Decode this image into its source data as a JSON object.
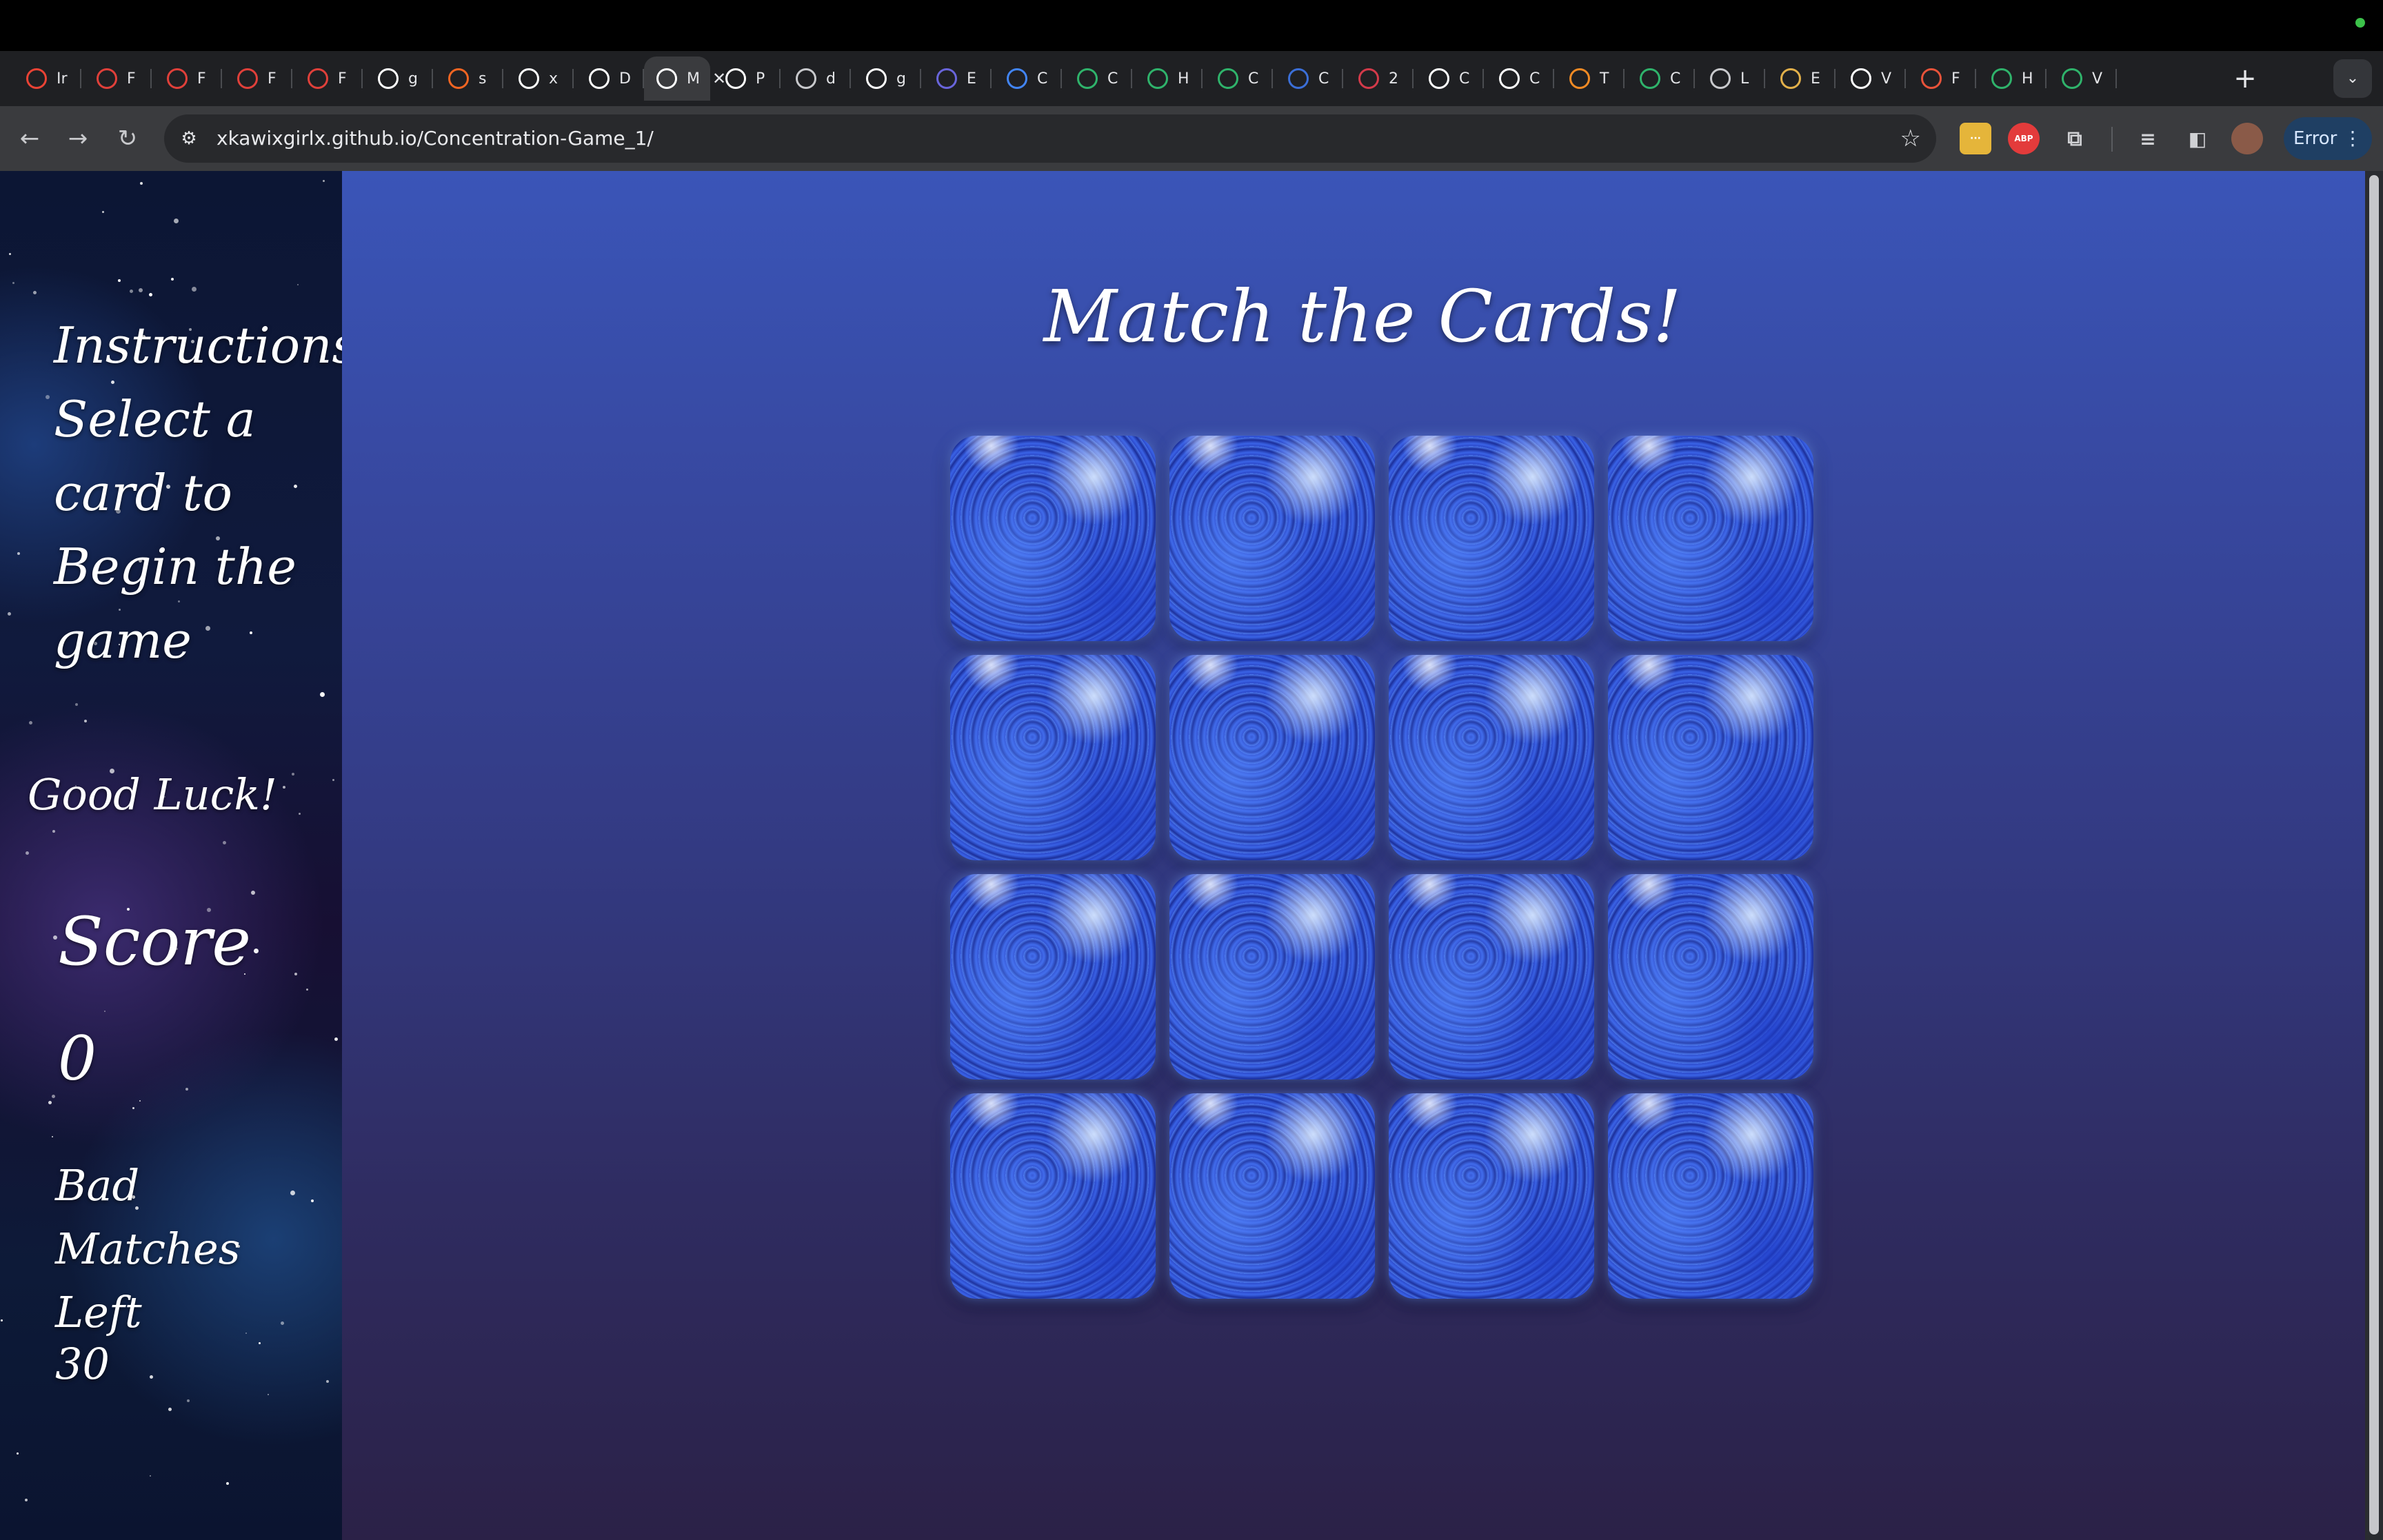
{
  "browser": {
    "tabs": [
      {
        "icon": "gmail-icon",
        "title": "Ir",
        "color": "#ea4335"
      },
      {
        "icon": "ga-icon",
        "title": "F",
        "color": "#e0403a"
      },
      {
        "icon": "ga-icon",
        "title": "F",
        "color": "#e0403a"
      },
      {
        "icon": "ga-icon",
        "title": "F",
        "color": "#e0403a"
      },
      {
        "icon": "ga-icon",
        "title": "F",
        "color": "#e0403a"
      },
      {
        "icon": "github-icon",
        "title": "g",
        "color": "#ffffff"
      },
      {
        "icon": "sourcetree-icon",
        "title": "s",
        "color": "#f26522"
      },
      {
        "icon": "github-icon",
        "title": "x",
        "color": "#ffffff"
      },
      {
        "icon": "github-icon",
        "title": "D",
        "color": "#ffffff"
      },
      {
        "icon": "page-icon",
        "title": "M",
        "color": "#ffffff",
        "active": true
      },
      {
        "icon": "github-icon",
        "title": "P",
        "color": "#ffffff"
      },
      {
        "icon": "globe-icon",
        "title": "d",
        "color": "#c8c9cc"
      },
      {
        "icon": "github-icon",
        "title": "g",
        "color": "#ffffff"
      },
      {
        "icon": "excalidraw-icon",
        "title": "E",
        "color": "#6965db"
      },
      {
        "icon": "google-icon",
        "title": "C",
        "color": "#4285f4"
      },
      {
        "icon": "wix-icon",
        "title": "C",
        "color": "#2fb36b"
      },
      {
        "icon": "wix-icon",
        "title": "H",
        "color": "#2fb36b"
      },
      {
        "icon": "wix-icon",
        "title": "C",
        "color": "#2fb36b"
      },
      {
        "icon": "moon-icon",
        "title": "C",
        "color": "#3b6fd8"
      },
      {
        "icon": "opera-icon",
        "title": "2",
        "color": "#d33a4a"
      },
      {
        "icon": "codepen-icon",
        "title": "C",
        "color": "#ffffff"
      },
      {
        "icon": "codepen-icon",
        "title": "C",
        "color": "#ffffff"
      },
      {
        "icon": "shapes-icon",
        "title": "T",
        "color": "#f08a24"
      },
      {
        "icon": "wix-icon",
        "title": "C",
        "color": "#2fb36b"
      },
      {
        "icon": "globe-icon",
        "title": "L",
        "color": "#c8c9cc"
      },
      {
        "icon": "sheet-icon",
        "title": "E",
        "color": "#e2b04a"
      },
      {
        "icon": "dev-icon",
        "title": "V",
        "color": "#ffffff"
      },
      {
        "icon": "asterisk-icon",
        "title": "F",
        "color": "#e8533a"
      },
      {
        "icon": "wix-icon",
        "title": "H",
        "color": "#2fb36b"
      },
      {
        "icon": "wix-icon",
        "title": "V",
        "color": "#2fb36b"
      }
    ],
    "address": "xkawixgirlx.github.io/Concentration-Game_1/",
    "error_label": "Error",
    "extensions": [
      {
        "name": "sticky-notes-icon",
        "color": "#e5b53a",
        "label": "···"
      },
      {
        "name": "adblock-icon",
        "color": "#e33b3b",
        "label": "ABP"
      },
      {
        "name": "puzzle-icon",
        "color": "transparent",
        "label": "⧉"
      }
    ]
  },
  "sidebar": {
    "instructions": "Instructions: Select a card to Begin the game",
    "good_luck": "Good Luck!",
    "score_label": "Score",
    "score_value": "0",
    "bad_matches_label": "Bad Matches Left",
    "bad_matches_value": "30"
  },
  "main": {
    "title": "Match the Cards!",
    "card_count": 16
  },
  "colors": {
    "main_top": "#3a55b8",
    "main_bottom": "#2b2147",
    "card": "#2a47c6",
    "error_button": "#1f3f63"
  }
}
